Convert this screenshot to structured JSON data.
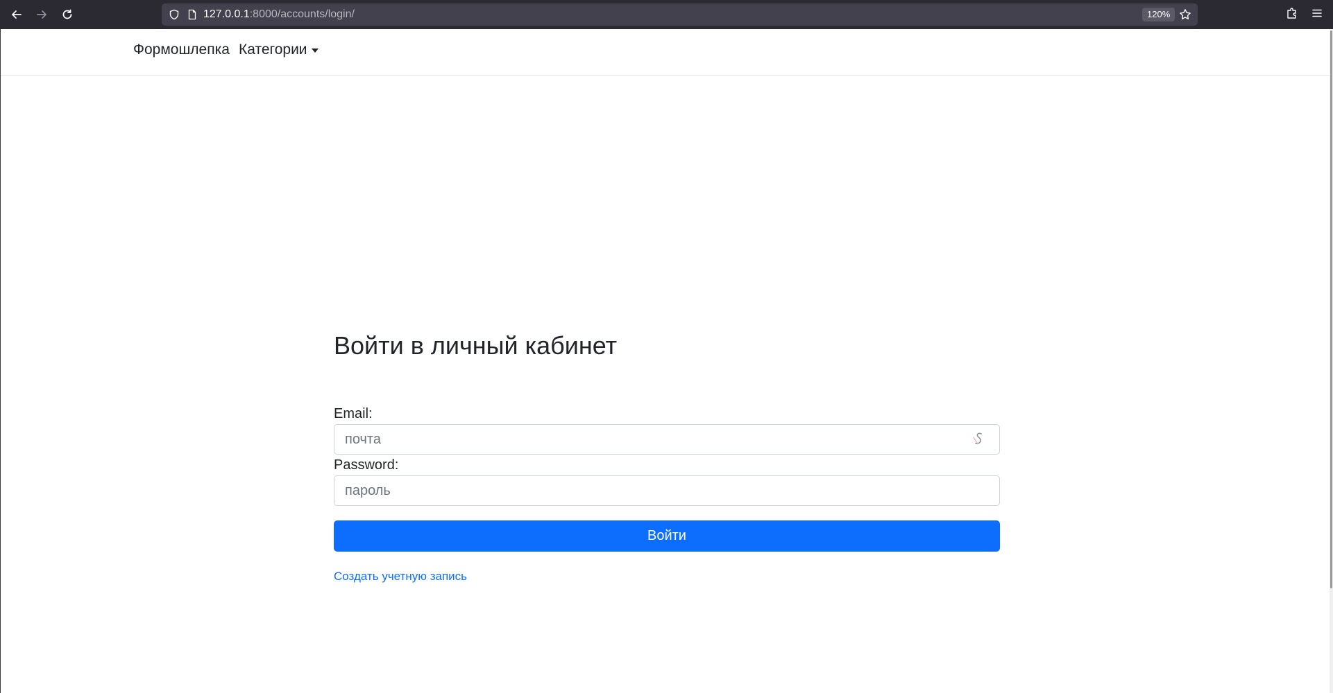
{
  "browser": {
    "url_host": "127.0.0.1",
    "url_rest": ":8000/accounts/login/",
    "zoom": "120%"
  },
  "navbar": {
    "brand": "Формошлепка",
    "categories_label": "Категории"
  },
  "login": {
    "title": "Войти в личный кабинет",
    "email_label": "Email:",
    "email_placeholder": "почта",
    "password_label": "Password:",
    "password_placeholder": "пароль",
    "submit_label": "Войти",
    "register_link": "Создать учетную запись"
  },
  "colors": {
    "primary": "#0d6efd",
    "chrome_bg": "#2b2a33",
    "urlbar_bg": "#42414d"
  }
}
